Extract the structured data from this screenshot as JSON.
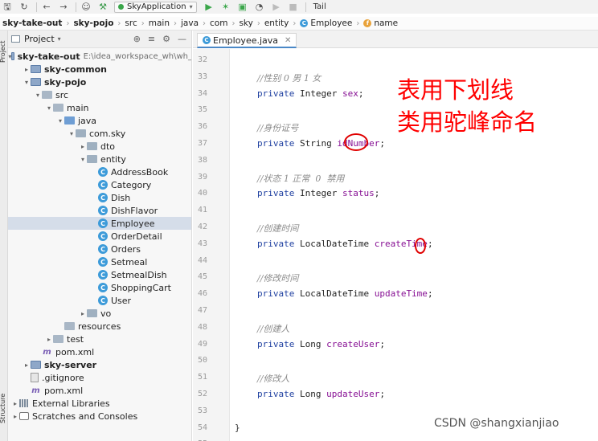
{
  "toolbar": {
    "run_config": "SkyApplication",
    "tail_label": "Tail",
    "icons": [
      "save-icon",
      "sync-icon",
      "back-icon",
      "forward-icon",
      "user-icon",
      "build-hammer-icon",
      "run-icon",
      "debug-icon",
      "coverage-icon",
      "profile-icon",
      "run-disabled-icon",
      "stop-icon"
    ]
  },
  "breadcrumb": [
    "sky-take-out",
    "sky-pojo",
    "src",
    "main",
    "java",
    "com",
    "sky",
    "entity",
    "Employee",
    "name"
  ],
  "left_strip": {
    "project_tab": "Project",
    "structure_tab": "Structure"
  },
  "project_panel": {
    "title": "Project",
    "tree": [
      {
        "label": "sky-take-out",
        "hint": "E:\\idea_workspace_wh\\wh_",
        "icon": "module-folder-icon",
        "bold": true,
        "arrow": "▾",
        "indent": 0
      },
      {
        "label": "sky-common",
        "icon": "module-folder-icon",
        "bold": true,
        "arrow": "▸",
        "indent": 1
      },
      {
        "label": "sky-pojo",
        "icon": "module-folder-icon",
        "bold": true,
        "arrow": "▾",
        "indent": 1
      },
      {
        "label": "src",
        "icon": "folder-icon",
        "arrow": "▾",
        "indent": 2
      },
      {
        "label": "main",
        "icon": "folder-icon",
        "arrow": "▾",
        "indent": 3
      },
      {
        "label": "java",
        "icon": "source-folder-icon",
        "arrow": "▾",
        "indent": 4
      },
      {
        "label": "com.sky",
        "icon": "package-icon",
        "arrow": "▾",
        "indent": 5
      },
      {
        "label": "dto",
        "icon": "package-icon",
        "arrow": "▸",
        "indent": 6
      },
      {
        "label": "entity",
        "icon": "package-icon",
        "arrow": "▾",
        "indent": 6
      },
      {
        "label": "AddressBook",
        "icon": "class-icon",
        "indent": 7
      },
      {
        "label": "Category",
        "icon": "class-icon",
        "indent": 7
      },
      {
        "label": "Dish",
        "icon": "class-icon",
        "indent": 7
      },
      {
        "label": "DishFlavor",
        "icon": "class-icon",
        "indent": 7
      },
      {
        "label": "Employee",
        "icon": "class-icon",
        "indent": 7,
        "selected": true
      },
      {
        "label": "OrderDetail",
        "icon": "class-icon",
        "indent": 7
      },
      {
        "label": "Orders",
        "icon": "class-icon",
        "indent": 7
      },
      {
        "label": "Setmeal",
        "icon": "class-icon",
        "indent": 7
      },
      {
        "label": "SetmealDish",
        "icon": "class-icon",
        "indent": 7
      },
      {
        "label": "ShoppingCart",
        "icon": "class-icon",
        "indent": 7
      },
      {
        "label": "User",
        "icon": "class-icon",
        "indent": 7
      },
      {
        "label": "vo",
        "icon": "package-icon",
        "arrow": "▸",
        "indent": 6
      },
      {
        "label": "resources",
        "icon": "folder-icon",
        "indent": 4
      },
      {
        "label": "test",
        "icon": "folder-icon",
        "arrow": "▸",
        "indent": 3
      },
      {
        "label": "pom.xml",
        "icon": "maven-icon",
        "indent": 2
      },
      {
        "label": "sky-server",
        "icon": "module-folder-icon",
        "bold": true,
        "arrow": "▸",
        "indent": 1
      },
      {
        "label": ".gitignore",
        "icon": "file-icon",
        "indent": 1
      },
      {
        "label": "pom.xml",
        "icon": "maven-icon",
        "indent": 1
      },
      {
        "label": "External Libraries",
        "icon": "libraries-icon",
        "arrow": "▸",
        "indent": 0
      },
      {
        "label": "Scratches and Consoles",
        "icon": "scratches-icon",
        "arrow": "▸",
        "indent": 0
      }
    ]
  },
  "editor": {
    "tab_label": "Employee.java",
    "lines": [
      {
        "n": "32",
        "parts": []
      },
      {
        "n": "33",
        "parts": [
          {
            "t": "//性别 0 男 1 女",
            "c": "cm"
          }
        ]
      },
      {
        "n": "34",
        "parts": [
          {
            "t": "private ",
            "c": "kw"
          },
          {
            "t": "Integer ",
            "c": "ty"
          },
          {
            "t": "sex",
            "c": "fld"
          },
          {
            "t": ";",
            "c": "ty"
          }
        ]
      },
      {
        "n": "35",
        "parts": []
      },
      {
        "n": "36",
        "parts": [
          {
            "t": "//身份证号",
            "c": "cm"
          }
        ]
      },
      {
        "n": "37",
        "parts": [
          {
            "t": "private ",
            "c": "kw"
          },
          {
            "t": "String ",
            "c": "ty"
          },
          {
            "t": "idNumber",
            "c": "fld"
          },
          {
            "t": ";",
            "c": "ty"
          }
        ]
      },
      {
        "n": "38",
        "parts": []
      },
      {
        "n": "39",
        "parts": [
          {
            "t": "//状态 1 正常  0  禁用",
            "c": "cm"
          }
        ]
      },
      {
        "n": "40",
        "parts": [
          {
            "t": "private ",
            "c": "kw"
          },
          {
            "t": "Integer ",
            "c": "ty"
          },
          {
            "t": "status",
            "c": "fld"
          },
          {
            "t": ";",
            "c": "ty"
          }
        ]
      },
      {
        "n": "41",
        "parts": []
      },
      {
        "n": "42",
        "parts": [
          {
            "t": "//创建时间",
            "c": "cm"
          }
        ]
      },
      {
        "n": "43",
        "parts": [
          {
            "t": "private ",
            "c": "kw"
          },
          {
            "t": "LocalDateTime ",
            "c": "ty"
          },
          {
            "t": "createTime",
            "c": "fld"
          },
          {
            "t": ";",
            "c": "ty"
          }
        ]
      },
      {
        "n": "44",
        "parts": []
      },
      {
        "n": "45",
        "parts": [
          {
            "t": "//修改时间",
            "c": "cm"
          }
        ]
      },
      {
        "n": "46",
        "parts": [
          {
            "t": "private ",
            "c": "kw"
          },
          {
            "t": "LocalDateTime ",
            "c": "ty"
          },
          {
            "t": "updateTime",
            "c": "fld"
          },
          {
            "t": ";",
            "c": "ty"
          }
        ]
      },
      {
        "n": "47",
        "parts": []
      },
      {
        "n": "48",
        "parts": [
          {
            "t": "//创建人",
            "c": "cm"
          }
        ]
      },
      {
        "n": "49",
        "parts": [
          {
            "t": "private ",
            "c": "kw"
          },
          {
            "t": "Long ",
            "c": "ty"
          },
          {
            "t": "createUser",
            "c": "fld"
          },
          {
            "t": ";",
            "c": "ty"
          }
        ]
      },
      {
        "n": "50",
        "parts": []
      },
      {
        "n": "51",
        "parts": [
          {
            "t": "//修改人",
            "c": "cm"
          }
        ]
      },
      {
        "n": "52",
        "parts": [
          {
            "t": "private ",
            "c": "kw"
          },
          {
            "t": "Long ",
            "c": "ty"
          },
          {
            "t": "updateUser",
            "c": "fld"
          },
          {
            "t": ";",
            "c": "ty"
          }
        ]
      },
      {
        "n": "53",
        "parts": []
      },
      {
        "n": "54",
        "parts": [
          {
            "t": "}",
            "c": "brace"
          }
        ]
      },
      {
        "n": "55",
        "parts": []
      }
    ]
  },
  "annotation": {
    "line1": "表用下划线",
    "line2": "类用驼峰命名"
  },
  "watermark": "CSDN @shangxianjiao",
  "colors": {
    "annotation": "#ff0000",
    "keyword": "#1e3fa0",
    "field": "#871094",
    "comment": "#8c8c8c",
    "selection": "#d5dde9"
  }
}
